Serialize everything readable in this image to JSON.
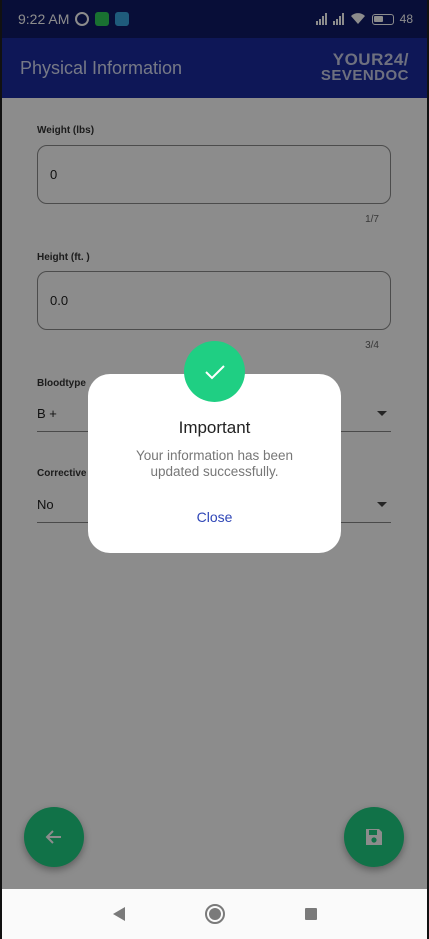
{
  "status_bar": {
    "time": "9:22 AM",
    "battery": "48"
  },
  "app_bar": {
    "title": "Physical Information",
    "logo_line1": "YOUR24/",
    "logo_line2": "SEVENDOC"
  },
  "form": {
    "weight": {
      "label": "Weight (lbs)",
      "value": "0",
      "counter": "1/7"
    },
    "height": {
      "label": "Height (ft. )",
      "value": "0.0",
      "counter": "3/4"
    },
    "bloodtype": {
      "label": "Bloodtype",
      "value": "B +"
    },
    "corrective": {
      "label": "Corrective",
      "value": "No"
    }
  },
  "dialog": {
    "title": "Important",
    "message": "Your information has been updated successfully.",
    "close_label": "Close"
  },
  "colors": {
    "primary": "#1a2b9e",
    "accent": "#1fcf83",
    "link": "#2f46b7"
  }
}
